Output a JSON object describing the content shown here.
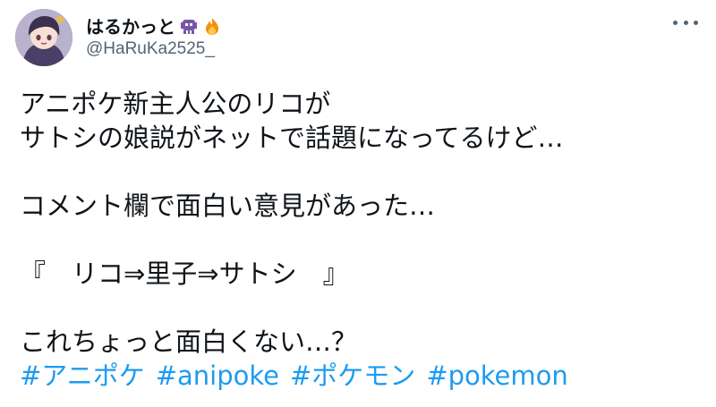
{
  "user": {
    "display_name": "はるかっと",
    "handle": "@HaRuKa2525_",
    "name_emojis": [
      "alien-monster-icon",
      "fire-icon"
    ]
  },
  "tweet": {
    "lines": [
      "アニポケ新主人公のリコが",
      "サトシの娘説がネットで話題になってるけど…",
      "",
      "コメント欄で面白い意見があった…",
      "",
      "『　リコ⇒里子⇒サトシ　』",
      "",
      "これちょっと面白くない…？"
    ],
    "hashtags": [
      "#アニポケ",
      "#anipoke",
      "#ポケモン",
      "#pokemon"
    ]
  },
  "colors": {
    "text": "#0f1419",
    "secondary": "#536471",
    "link": "#1d9bf0"
  }
}
